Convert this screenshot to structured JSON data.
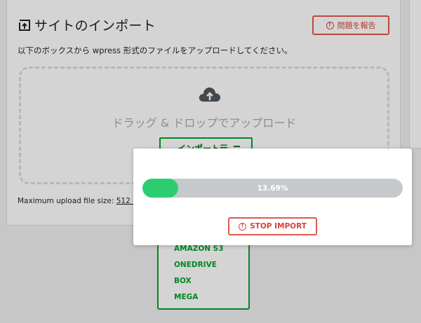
{
  "header": {
    "title": "サイトのインポート",
    "title_icon": "import-icon",
    "report_label": "問題を報告"
  },
  "main": {
    "instructions": "以下のボックスから wpress 形式のファイルをアップロードしてください。",
    "drop_text": "ドラッグ & ドロップでアップロード",
    "upload_icon": "cloud-upload-icon",
    "import_to_label": "インポート元",
    "max_upload_label": "Maximum upload file size:",
    "max_upload_value": "512 MB"
  },
  "dropdown": {
    "items": [
      "AMAZON S3",
      "ONEDRIVE",
      "BOX",
      "MEGA"
    ]
  },
  "modal": {
    "progress_percent": 13.69,
    "progress_text": "13.69%",
    "stop_label": "STOP IMPORT",
    "stop_icon": "alert-circle-icon"
  },
  "colors": {
    "progress_fill": "#2ecc71",
    "progress_track": "#c5c9cc",
    "danger": "#e0584b",
    "accent_green": "#00a32a"
  }
}
